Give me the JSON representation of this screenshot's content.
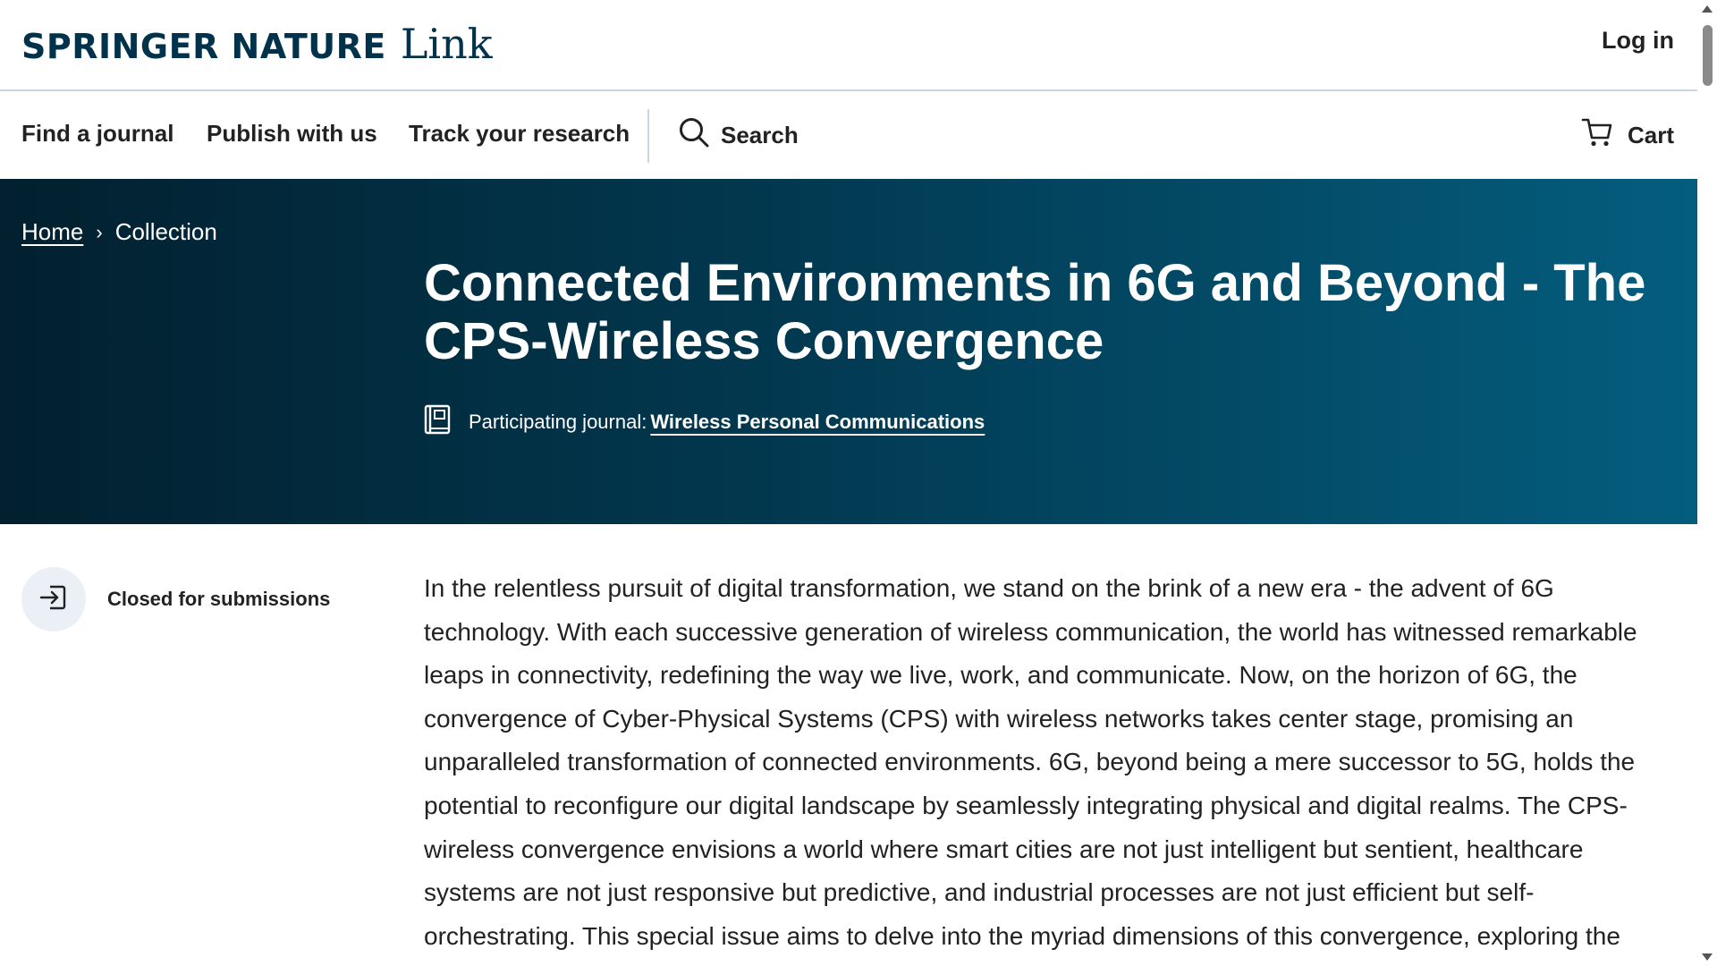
{
  "header": {
    "logo_main": "SPRINGER NATURE",
    "logo_sub": "Link",
    "login_label": "Log in"
  },
  "nav": {
    "items": [
      "Find a journal",
      "Publish with us",
      "Track your research"
    ],
    "search_label": "Search",
    "cart_label": "Cart"
  },
  "breadcrumb": {
    "home": "Home",
    "separator": "›",
    "current": "Collection"
  },
  "hero": {
    "title": "Connected Environments in 6G and Beyond - The CPS-Wireless Convergence",
    "journal_prefix": "Participating journal:",
    "journal_name": "Wireless Personal Communications"
  },
  "status": {
    "label": "Closed for submissions"
  },
  "body": {
    "description": "In the relentless pursuit of digital transformation, we stand on the brink of a new era - the advent of 6G technology. With each successive generation of wireless communication, the world has witnessed remarkable leaps in connectivity, redefining the way we live, work, and communicate. Now, on the horizon of 6G, the convergence of Cyber-Physical Systems (CPS) with wireless networks takes center stage, promising an unparalleled transformation of connected environments. 6G, beyond being a mere successor to 5G, holds the potential to reconfigure our digital landscape by seamlessly integrating physical and digital realms. The CPS-wireless convergence envisions a world where smart cities are not just intelligent but sentient, healthcare systems are not just responsive but predictive, and industrial processes are not just efficient but self-orchestrating. This special issue aims to delve into the myriad dimensions of this convergence, exploring the"
  },
  "colors": {
    "brand": "#01324b",
    "hero_start": "#02202f",
    "hero_end": "#045d7e"
  }
}
